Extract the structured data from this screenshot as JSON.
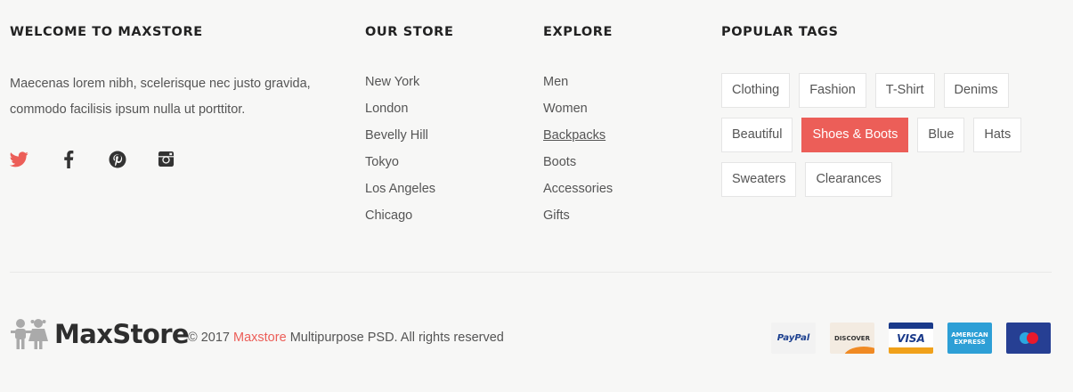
{
  "welcome": {
    "title": "WELCOME TO MAXSTORE",
    "text": "Maecenas lorem nibh, scelerisque nec justo gravida, commodo facilisis ipsum nulla ut porttitor.",
    "social_icons": [
      "twitter-icon",
      "facebook-icon",
      "pinterest-icon",
      "instagram-icon"
    ]
  },
  "store": {
    "title": "OUR STORE",
    "items": [
      "New York",
      "London",
      "Bevelly Hill",
      "Tokyo",
      "Los Angeles",
      "Chicago"
    ]
  },
  "explore": {
    "title": "EXPLORE",
    "items": [
      "Men",
      "Women",
      "Backpacks",
      "Boots",
      "Accessories",
      "Gifts"
    ],
    "active_item": "Backpacks"
  },
  "tags": {
    "title": "POPULAR TAGS",
    "items": [
      "Clothing",
      "Fashion",
      "T-Shirt",
      "Denims",
      "Beautiful",
      "Shoes & Boots",
      "Blue",
      "Hats",
      "Sweaters",
      "Clearances"
    ],
    "highlighted": "Shoes & Boots"
  },
  "bottom": {
    "logo_text": "MaxStore",
    "copyright_prefix": "© 2017",
    "brand": "Maxstore",
    "copyright_suffix": "Multipurpose PSD. All rights reserved",
    "payments": [
      {
        "name": "PayPal",
        "label": "PayPal"
      },
      {
        "name": "Discover",
        "label": "DISCOVER"
      },
      {
        "name": "Visa",
        "label": "VISA"
      },
      {
        "name": "American Express",
        "label": "AMERICAN EXPRESS"
      },
      {
        "name": "Maestro",
        "label": ""
      }
    ]
  },
  "colors": {
    "accent": "#ec5e58",
    "heading": "#222222",
    "text": "#555555",
    "background": "#f7f7f6"
  }
}
